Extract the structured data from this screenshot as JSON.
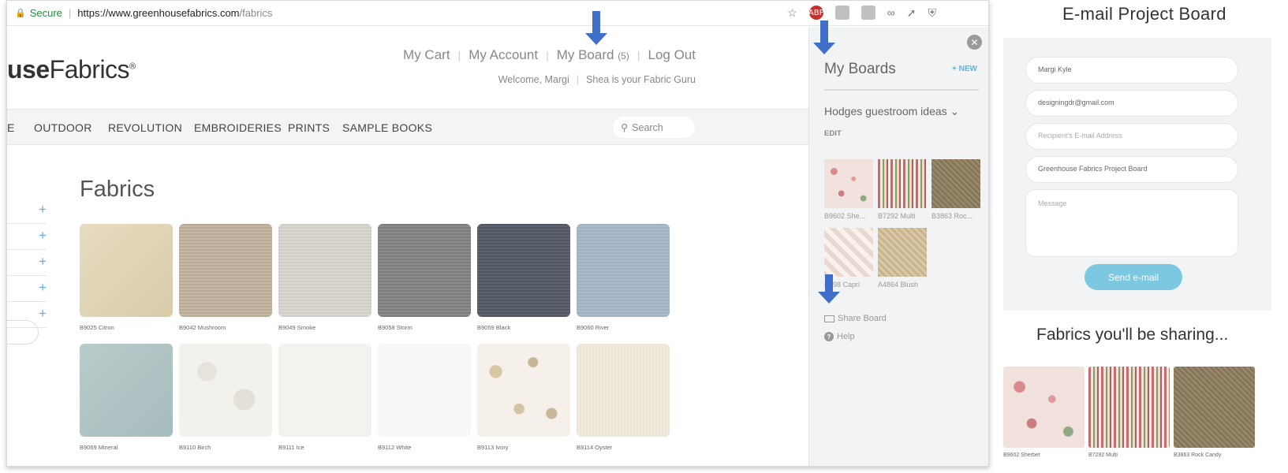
{
  "browser": {
    "secure_label": "Secure",
    "url_host": "https://www.greenhousefabrics.com",
    "url_path": "/fabrics",
    "ext_badge": "ABP"
  },
  "site": {
    "logo_bold": "use",
    "logo_rest": "Fabrics",
    "logo_mark": "®",
    "topnav": {
      "cart": "My Cart",
      "account": "My Account",
      "board": "My Board",
      "board_count": "(5)",
      "logout": "Log Out"
    },
    "welcome": "Welcome, Margi",
    "guru": "Shea is your Fabric Guru",
    "categories": [
      "E",
      "OUTDOOR",
      "REVOLUTION",
      "EMBROIDERIES",
      "PRINTS",
      "SAMPLE BOOKS"
    ],
    "search_placeholder": "Search",
    "heading": "Fabrics",
    "filter_plus": "+",
    "fabrics": [
      {
        "code": "B9025 Citron",
        "texture": "citron"
      },
      {
        "code": "B9042 Mushroom",
        "texture": "mushroom"
      },
      {
        "code": "B9049 Smoke",
        "texture": "smoke"
      },
      {
        "code": "B9058 Storm",
        "texture": "storm"
      },
      {
        "code": "B9059 Black",
        "texture": "black"
      },
      {
        "code": "B9060 River",
        "texture": "river"
      },
      {
        "code": "B9069 Mineral",
        "texture": "mineral"
      },
      {
        "code": "B9110 Birch",
        "texture": "birch"
      },
      {
        "code": "B9111 Ice",
        "texture": "ice"
      },
      {
        "code": "B9112 White",
        "texture": "white"
      },
      {
        "code": "B9113 Ivory",
        "texture": "ivory"
      },
      {
        "code": "B9114 Oyster",
        "texture": "oyster"
      }
    ]
  },
  "boards": {
    "title": "My Boards",
    "new_label": "+ NEW",
    "board_name": "Hodges guestroom ideas",
    "edit_label": "EDIT",
    "items": [
      {
        "label": "B9602 She...",
        "texture": "sherbet"
      },
      {
        "label": "B7292 Multi",
        "texture": "multi"
      },
      {
        "label": "B3863 Roc...",
        "texture": "rockcandy"
      },
      {
        "label": "B498 Capri",
        "texture": "capri"
      },
      {
        "label": "A4864 Blush",
        "texture": "blush"
      }
    ],
    "share_label": "Share Board",
    "help_label": "Help"
  },
  "email": {
    "title": "E-mail Project Board",
    "name_value": "Margi Kyle",
    "email_value": "designingdr@gmail.com",
    "recipient_placeholder": "Recipient's E-mail Address",
    "subject_value": "Greenhouse Fabrics Project Board",
    "message_placeholder": "Message",
    "send_label": "Send e-mail",
    "sharing_heading": "Fabrics you'll be sharing...",
    "shared": [
      {
        "label": "B9602 Sherbet",
        "texture": "sherbet"
      },
      {
        "label": "B7292 Multi",
        "texture": "multi"
      },
      {
        "label": "B3863 Rock Candy",
        "texture": "rockcandy"
      }
    ]
  },
  "colors": {
    "accent_blue": "#3f6fc8",
    "link_blue": "#58b7de",
    "send_button": "#7bc8e0",
    "secure_green": "#1e8e3e"
  }
}
